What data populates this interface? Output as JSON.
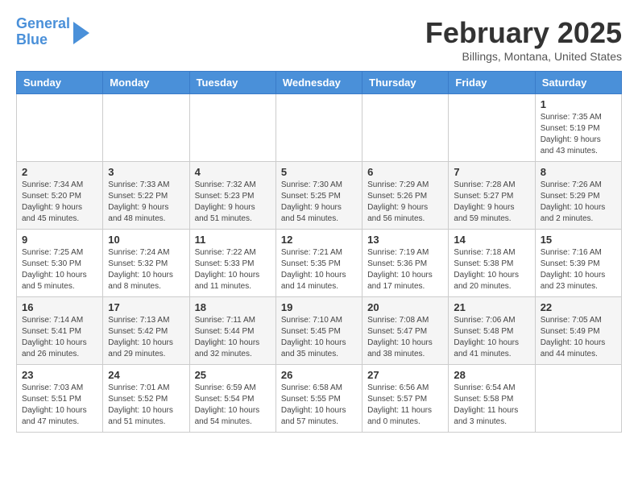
{
  "header": {
    "logo_line1": "General",
    "logo_line2": "Blue",
    "title": "February 2025",
    "subtitle": "Billings, Montana, United States"
  },
  "days_of_week": [
    "Sunday",
    "Monday",
    "Tuesday",
    "Wednesday",
    "Thursday",
    "Friday",
    "Saturday"
  ],
  "weeks": [
    [
      {
        "day": "",
        "info": ""
      },
      {
        "day": "",
        "info": ""
      },
      {
        "day": "",
        "info": ""
      },
      {
        "day": "",
        "info": ""
      },
      {
        "day": "",
        "info": ""
      },
      {
        "day": "",
        "info": ""
      },
      {
        "day": "1",
        "info": "Sunrise: 7:35 AM\nSunset: 5:19 PM\nDaylight: 9 hours and 43 minutes."
      }
    ],
    [
      {
        "day": "2",
        "info": "Sunrise: 7:34 AM\nSunset: 5:20 PM\nDaylight: 9 hours and 45 minutes."
      },
      {
        "day": "3",
        "info": "Sunrise: 7:33 AM\nSunset: 5:22 PM\nDaylight: 9 hours and 48 minutes."
      },
      {
        "day": "4",
        "info": "Sunrise: 7:32 AM\nSunset: 5:23 PM\nDaylight: 9 hours and 51 minutes."
      },
      {
        "day": "5",
        "info": "Sunrise: 7:30 AM\nSunset: 5:25 PM\nDaylight: 9 hours and 54 minutes."
      },
      {
        "day": "6",
        "info": "Sunrise: 7:29 AM\nSunset: 5:26 PM\nDaylight: 9 hours and 56 minutes."
      },
      {
        "day": "7",
        "info": "Sunrise: 7:28 AM\nSunset: 5:27 PM\nDaylight: 9 hours and 59 minutes."
      },
      {
        "day": "8",
        "info": "Sunrise: 7:26 AM\nSunset: 5:29 PM\nDaylight: 10 hours and 2 minutes."
      }
    ],
    [
      {
        "day": "9",
        "info": "Sunrise: 7:25 AM\nSunset: 5:30 PM\nDaylight: 10 hours and 5 minutes."
      },
      {
        "day": "10",
        "info": "Sunrise: 7:24 AM\nSunset: 5:32 PM\nDaylight: 10 hours and 8 minutes."
      },
      {
        "day": "11",
        "info": "Sunrise: 7:22 AM\nSunset: 5:33 PM\nDaylight: 10 hours and 11 minutes."
      },
      {
        "day": "12",
        "info": "Sunrise: 7:21 AM\nSunset: 5:35 PM\nDaylight: 10 hours and 14 minutes."
      },
      {
        "day": "13",
        "info": "Sunrise: 7:19 AM\nSunset: 5:36 PM\nDaylight: 10 hours and 17 minutes."
      },
      {
        "day": "14",
        "info": "Sunrise: 7:18 AM\nSunset: 5:38 PM\nDaylight: 10 hours and 20 minutes."
      },
      {
        "day": "15",
        "info": "Sunrise: 7:16 AM\nSunset: 5:39 PM\nDaylight: 10 hours and 23 minutes."
      }
    ],
    [
      {
        "day": "16",
        "info": "Sunrise: 7:14 AM\nSunset: 5:41 PM\nDaylight: 10 hours and 26 minutes."
      },
      {
        "day": "17",
        "info": "Sunrise: 7:13 AM\nSunset: 5:42 PM\nDaylight: 10 hours and 29 minutes."
      },
      {
        "day": "18",
        "info": "Sunrise: 7:11 AM\nSunset: 5:44 PM\nDaylight: 10 hours and 32 minutes."
      },
      {
        "day": "19",
        "info": "Sunrise: 7:10 AM\nSunset: 5:45 PM\nDaylight: 10 hours and 35 minutes."
      },
      {
        "day": "20",
        "info": "Sunrise: 7:08 AM\nSunset: 5:47 PM\nDaylight: 10 hours and 38 minutes."
      },
      {
        "day": "21",
        "info": "Sunrise: 7:06 AM\nSunset: 5:48 PM\nDaylight: 10 hours and 41 minutes."
      },
      {
        "day": "22",
        "info": "Sunrise: 7:05 AM\nSunset: 5:49 PM\nDaylight: 10 hours and 44 minutes."
      }
    ],
    [
      {
        "day": "23",
        "info": "Sunrise: 7:03 AM\nSunset: 5:51 PM\nDaylight: 10 hours and 47 minutes."
      },
      {
        "day": "24",
        "info": "Sunrise: 7:01 AM\nSunset: 5:52 PM\nDaylight: 10 hours and 51 minutes."
      },
      {
        "day": "25",
        "info": "Sunrise: 6:59 AM\nSunset: 5:54 PM\nDaylight: 10 hours and 54 minutes."
      },
      {
        "day": "26",
        "info": "Sunrise: 6:58 AM\nSunset: 5:55 PM\nDaylight: 10 hours and 57 minutes."
      },
      {
        "day": "27",
        "info": "Sunrise: 6:56 AM\nSunset: 5:57 PM\nDaylight: 11 hours and 0 minutes."
      },
      {
        "day": "28",
        "info": "Sunrise: 6:54 AM\nSunset: 5:58 PM\nDaylight: 11 hours and 3 minutes."
      },
      {
        "day": "",
        "info": ""
      }
    ]
  ]
}
